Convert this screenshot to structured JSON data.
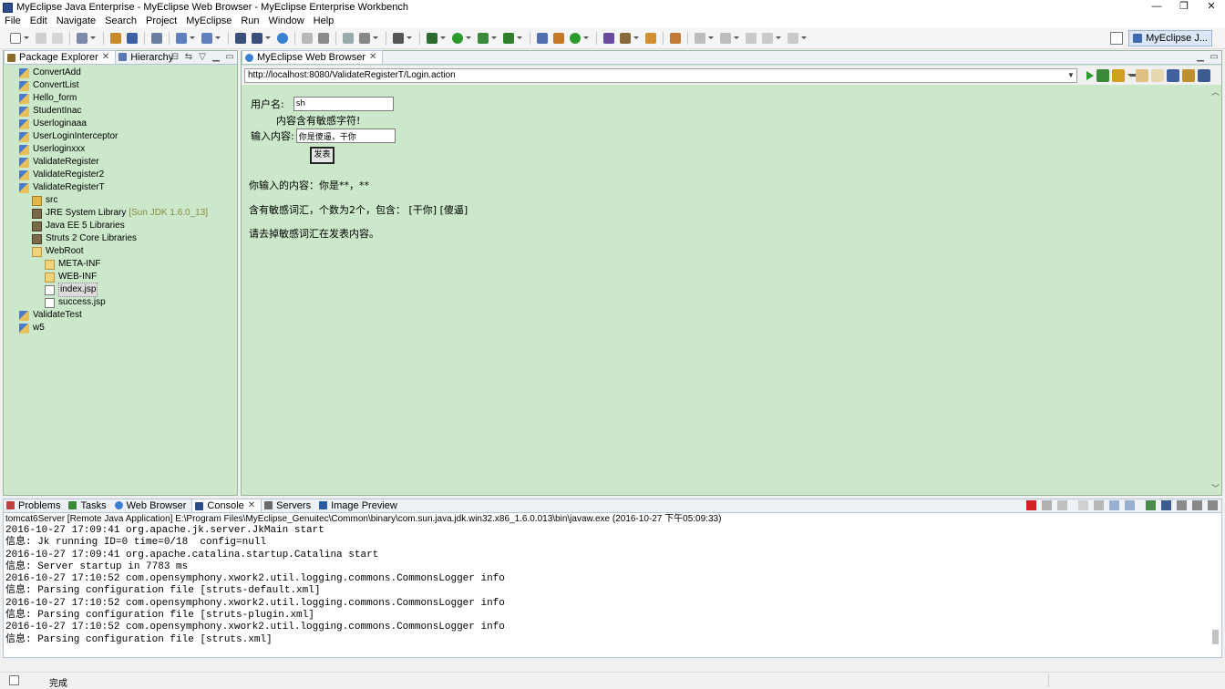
{
  "window": {
    "title": "MyEclipse Java Enterprise - MyEclipse Web Browser - MyEclipse Enterprise Workbench",
    "controls": [
      "—",
      "❐",
      "✕"
    ]
  },
  "menu": [
    "File",
    "Edit",
    "Navigate",
    "Search",
    "Project",
    "MyEclipse",
    "Run",
    "Window",
    "Help"
  ],
  "perspective": {
    "label": "MyEclipse J..."
  },
  "left_panel": {
    "tabs": [
      {
        "label": "Package Explorer",
        "icon": "package-explorer-icon",
        "active": true
      },
      {
        "label": "Hierarchy",
        "icon": "hierarchy-icon",
        "active": false
      }
    ],
    "tree": [
      {
        "label": "ConvertAdd",
        "icon": "project",
        "depth": 0
      },
      {
        "label": "ConvertList",
        "icon": "project",
        "depth": 0
      },
      {
        "label": "Hello_form",
        "icon": "project",
        "depth": 0
      },
      {
        "label": "StudentInac",
        "icon": "project",
        "depth": 0
      },
      {
        "label": "Userloginaaa",
        "icon": "project",
        "depth": 0
      },
      {
        "label": "UserLoginInterceptor",
        "icon": "project",
        "depth": 0
      },
      {
        "label": "Userloginxxx",
        "icon": "project",
        "depth": 0
      },
      {
        "label": "ValidateRegister",
        "icon": "project",
        "depth": 0
      },
      {
        "label": "ValidateRegister2",
        "icon": "project",
        "depth": 0
      },
      {
        "label": "ValidateRegisterT",
        "icon": "project",
        "depth": 0
      },
      {
        "label": "src",
        "icon": "src",
        "depth": 1
      },
      {
        "label": "JRE System Library",
        "deco": "[Sun JDK 1.6.0_13]",
        "icon": "lib",
        "depth": 1
      },
      {
        "label": "Java EE 5 Libraries",
        "icon": "lib",
        "depth": 1
      },
      {
        "label": "Struts 2 Core Libraries",
        "icon": "lib",
        "depth": 1
      },
      {
        "label": "WebRoot",
        "icon": "folder",
        "depth": 1
      },
      {
        "label": "META-INF",
        "icon": "folder",
        "depth": 2
      },
      {
        "label": "WEB-INF",
        "icon": "folder",
        "depth": 2
      },
      {
        "label": "index.jsp",
        "icon": "jsp",
        "depth": 2,
        "selected": true
      },
      {
        "label": "success.jsp",
        "icon": "jsp",
        "depth": 2
      },
      {
        "label": "ValidateTest",
        "icon": "project",
        "depth": 0
      },
      {
        "label": "w5",
        "icon": "project",
        "depth": 0
      }
    ]
  },
  "browser": {
    "tab_label": "MyEclipse Web Browser",
    "url": "http://localhost:8080/ValidateRegisterT/Login.action",
    "page": {
      "username_label": "用户名:",
      "username_value": "sh",
      "error_message": "内容含有敏感字符!",
      "content_label": "输入内容:",
      "content_value": "你是傻逼，干你",
      "submit_label": "发表",
      "result_line": "你输入的内容：你是**，**",
      "sensitive_line": "含有敏感词汇，个数为2个，包含：  [干你]  [傻逼]",
      "advice_line": "请去掉敏感词汇在发表内容。"
    }
  },
  "bottom_panel": {
    "tabs": [
      {
        "label": "Problems",
        "icon": "problems-icon",
        "active": false
      },
      {
        "label": "Tasks",
        "icon": "tasks-icon",
        "active": false
      },
      {
        "label": "Web Browser",
        "icon": "web-browser-icon",
        "active": false
      },
      {
        "label": "Console",
        "icon": "console-icon",
        "active": true
      },
      {
        "label": "Servers",
        "icon": "servers-icon",
        "active": false
      },
      {
        "label": "Image Preview",
        "icon": "image-preview-icon",
        "active": false
      }
    ],
    "console_description": "tomcat6Server [Remote Java Application] E:\\Program Files\\MyEclipse_Genuitec\\Common\\binary\\com.sun.java.jdk.win32.x86_1.6.0.013\\bin\\javaw.exe (2016-10-27 下午05:09:33)",
    "console_lines": [
      "2016-10-27 17:09:41 org.apache.jk.server.JkMain start",
      "信息: Jk running ID=0 time=0/18  config=null",
      "2016-10-27 17:09:41 org.apache.catalina.startup.Catalina start",
      "信息: Server startup in 7783 ms",
      "2016-10-27 17:10:52 com.opensymphony.xwork2.util.logging.commons.CommonsLogger info",
      "信息: Parsing configuration file [struts-default.xml]",
      "2016-10-27 17:10:52 com.opensymphony.xwork2.util.logging.commons.CommonsLogger info",
      "信息: Parsing configuration file [struts-plugin.xml]",
      "2016-10-27 17:10:52 com.opensymphony.xwork2.util.logging.commons.CommonsLogger info",
      "信息: Parsing configuration file [struts.xml]"
    ]
  },
  "status": {
    "text": "完成"
  },
  "colors": {
    "panel_bg": "#cbe8cb",
    "project_icon": "#4a7cc9",
    "run_green": "#2a9a2a",
    "stop_red": "#d02020"
  }
}
